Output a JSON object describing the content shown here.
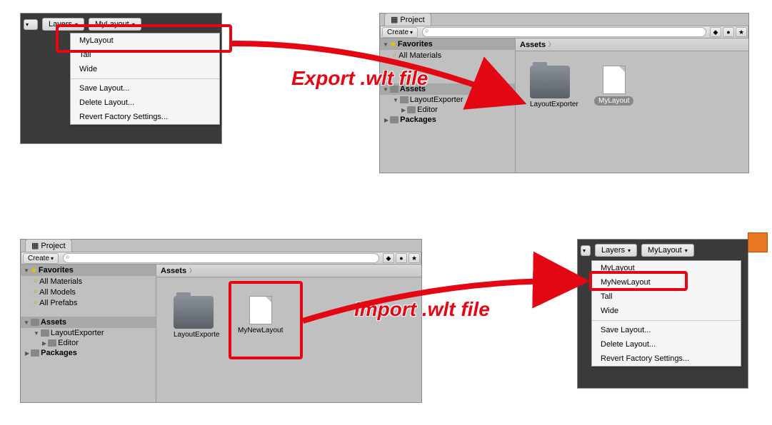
{
  "dropdowns": {
    "layers": "Layers",
    "layout": "MyLayout"
  },
  "menu1": {
    "items": [
      "MyLayout",
      "Tall",
      "Wide"
    ],
    "extras": [
      "Save Layout...",
      "Delete Layout...",
      "Revert Factory Settings..."
    ]
  },
  "menu2": {
    "items": [
      "MyLayout",
      "MyNewLayout",
      "Tall",
      "Wide"
    ],
    "extras": [
      "Save Layout...",
      "Delete Layout...",
      "Revert Factory Settings..."
    ]
  },
  "project": {
    "tab": "Project",
    "create": "Create",
    "favorites_hdr": "Favorites",
    "fav1": "All Materials",
    "fav1a": "All Materials",
    "fav2a": "All Models",
    "fav3a": "All Prefabs",
    "assets_hdr": "Assets",
    "folder1": "LayoutExporter",
    "folder2": "Editor",
    "packages": "Packages",
    "breadcrumb": "Assets",
    "asset_folder": "LayoutExporter",
    "asset_folder2": "LayoutExporte",
    "asset_file1": "MyLayout",
    "asset_file2": "MyNewLayout"
  },
  "annot": {
    "export": "Export .wlt file",
    "import": "Import .wlt file"
  }
}
